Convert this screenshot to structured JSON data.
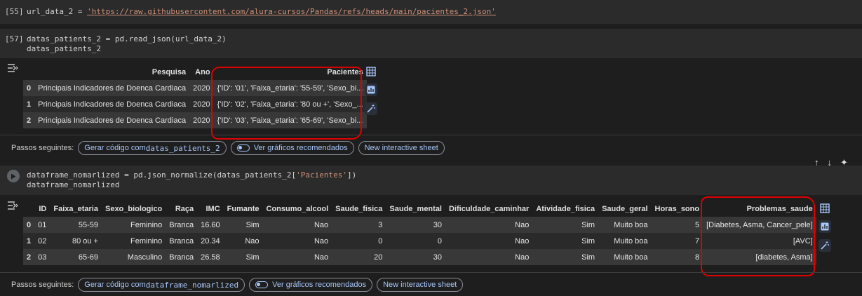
{
  "cell1": {
    "exec_label": "[55]",
    "var": "url_data_2",
    "op": " = ",
    "url": "'https://raw.githubusercontent.com/alura-cursos/Pandas/refs/heads/main/pacientes_2.json'"
  },
  "cell2": {
    "exec_label": "[57]",
    "line1_a": "datas_patients_2 = pd.read_json(url_data_2)",
    "line2": "datas_patients_2",
    "table": {
      "headers": [
        "",
        "Pesquisa",
        "Ano",
        "Pacientes"
      ],
      "rows": [
        [
          "0",
          "Principais Indicadores de Doenca Cardiaca",
          "2020",
          "{'ID': '01', 'Faixa_etaria': '55-59', 'Sexo_bi..."
        ],
        [
          "1",
          "Principais Indicadores de Doenca Cardiaca",
          "2020",
          "{'ID': '02', 'Faixa_etaria': '80 ou +', 'Sexo_..."
        ],
        [
          "2",
          "Principais Indicadores de Doenca Cardiaca",
          "2020",
          "{'ID': '03', 'Faixa_etaria': '65-69', 'Sexo_bi..."
        ]
      ]
    },
    "next_steps": {
      "label": "Passos seguintes:",
      "chip1_prefix": "Gerar código com ",
      "chip1_code": "datas_patients_2",
      "chip2": "Ver gráficos recomendados",
      "chip3": "New interactive sheet"
    }
  },
  "cell3": {
    "line1_a": "dataframe_nomarlized = pd.json_normalize(datas_patients_2[",
    "line1_str": "'Pacientes'",
    "line1_b": "])",
    "line2": "dataframe_nomarlized",
    "table": {
      "headers": [
        "",
        "ID",
        "Faixa_etaria",
        "Sexo_biologico",
        "Raça",
        "IMC",
        "Fumante",
        "Consumo_alcool",
        "Saude_fisica",
        "Saude_mental",
        "Dificuldade_caminhar",
        "Atividade_fisica",
        "Saude_geral",
        "Horas_sono",
        "Problemas_saude"
      ],
      "rows": [
        [
          "0",
          "01",
          "55-59",
          "Feminino",
          "Branca",
          "16.60",
          "Sim",
          "Nao",
          "3",
          "30",
          "Nao",
          "Sim",
          "Muito boa",
          "5",
          "[Diabetes, Asma, Cancer_pele]"
        ],
        [
          "1",
          "02",
          "80 ou +",
          "Feminino",
          "Branca",
          "20.34",
          "Nao",
          "Nao",
          "0",
          "0",
          "Nao",
          "Sim",
          "Muito boa",
          "7",
          "[AVC]"
        ],
        [
          "2",
          "03",
          "65-69",
          "Masculino",
          "Branca",
          "26.58",
          "Sim",
          "Nao",
          "20",
          "30",
          "Nao",
          "Sim",
          "Muito boa",
          "8",
          "[diabetes, Asma]"
        ]
      ]
    },
    "next_steps": {
      "label": "Passos seguintes:",
      "chip1_prefix": "Gerar código com ",
      "chip1_code": "dataframe_nomarlized",
      "chip2": "Ver gráficos recomendados",
      "chip3": "New interactive sheet"
    }
  },
  "colors": {
    "background": "#1e1e1e",
    "code_bg": "#2b2b2b",
    "accent": "#a8c7fa",
    "highlight": "#e00000",
    "string": "#ce9178"
  },
  "icons": {
    "output": "output-arrow-icon",
    "table": "table-icon",
    "chart": "chart-icon",
    "magic": "magic-wand-icon",
    "run": "play-icon",
    "up": "arrow-up-icon",
    "down": "arrow-down-icon",
    "sparkle": "sparkle-icon"
  }
}
